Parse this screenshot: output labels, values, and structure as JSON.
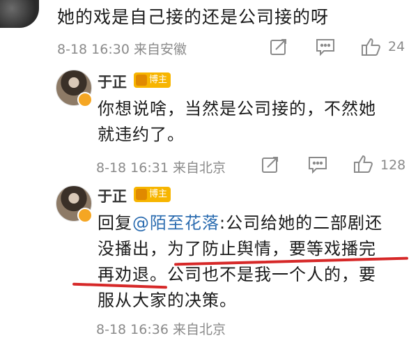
{
  "comment": {
    "text": "她的戏是自己接的还是公司接的呀",
    "date": "8-18",
    "time": "16:30",
    "location": "来自安徽",
    "like_count": "24"
  },
  "reply1": {
    "username": "于正",
    "badge": "博主",
    "text_line1": "你想说啥，当然是公司接的，不然她",
    "text_line2": "就违约了。",
    "date": "8-18",
    "time": "16:31",
    "location": "来自北京",
    "like_count": "128"
  },
  "reply2": {
    "username": "于正",
    "badge": "博主",
    "prefix": "回复",
    "mention": "@陌至花落",
    "text_line1_rest": ":公司给她的二部剧还",
    "text_line2": "没播出，为了防止舆情，要等戏播完",
    "text_line3": "再劝退。公司也不是我一个人的，要",
    "text_line4": "服从大家的决策。",
    "meta_partial": "8-18 16:36 来自北京"
  },
  "colors": {
    "accent_badge": "#f7b500",
    "mention": "#2b6cb0",
    "annotation_underline": "#d62828",
    "meta_text": "#8a8a8a"
  }
}
